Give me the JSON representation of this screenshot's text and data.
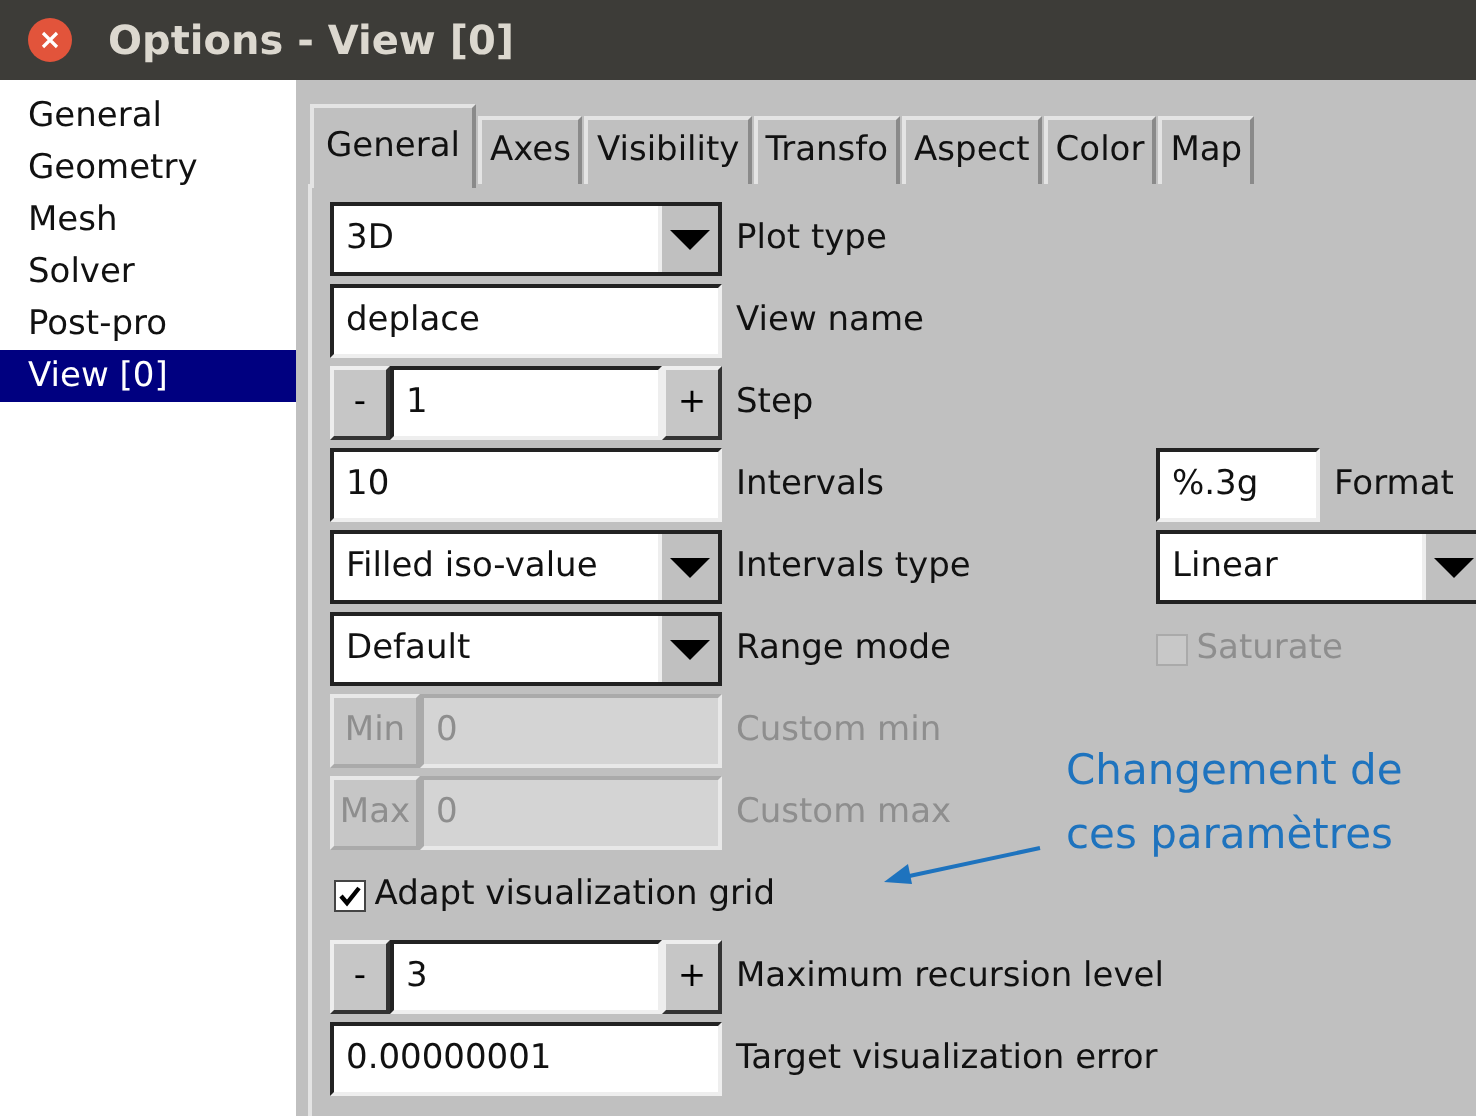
{
  "window": {
    "title": "Options - View [0]"
  },
  "sidebar": {
    "items": [
      {
        "label": "General",
        "selected": false
      },
      {
        "label": "Geometry",
        "selected": false
      },
      {
        "label": "Mesh",
        "selected": false
      },
      {
        "label": "Solver",
        "selected": false
      },
      {
        "label": "Post-pro",
        "selected": false
      },
      {
        "label": "View [0]",
        "selected": true
      }
    ]
  },
  "tabs": [
    {
      "label": "General",
      "selected": true
    },
    {
      "label": "Axes",
      "selected": false
    },
    {
      "label": "Visibility",
      "selected": false
    },
    {
      "label": "Transfo",
      "selected": false
    },
    {
      "label": "Aspect",
      "selected": false
    },
    {
      "label": "Color",
      "selected": false
    },
    {
      "label": "Map",
      "selected": false
    }
  ],
  "rows": [
    {
      "kind": "dropdown",
      "value": "3D",
      "label": "Plot type",
      "disabled": false
    },
    {
      "kind": "text",
      "value": "deplace",
      "label": "View name",
      "disabled": false
    },
    {
      "kind": "spinner",
      "minus": "-",
      "value": "1",
      "plus": "+",
      "label": "Step",
      "disabled": false
    },
    {
      "kind": "text",
      "value": "10",
      "label": "Intervals",
      "disabled": false,
      "extra": {
        "kind": "text",
        "value": "%.3g",
        "label": "Format",
        "disabled": false
      }
    },
    {
      "kind": "dropdown",
      "value": "Filled iso-value",
      "label": "Intervals type",
      "disabled": false,
      "extra": {
        "kind": "dropdown",
        "value": "Linear",
        "disabled": false
      }
    },
    {
      "kind": "dropdown",
      "value": "Default",
      "label": "Range mode",
      "disabled": false,
      "extra": {
        "kind": "checkbox",
        "text": "Saturate",
        "checked": false,
        "disabled": true
      }
    },
    {
      "kind": "button-input",
      "button": "Min",
      "value": "0",
      "label": "Custom min",
      "disabled": true
    },
    {
      "kind": "button-input",
      "button": "Max",
      "value": "0",
      "label": "Custom max",
      "disabled": true
    },
    {
      "kind": "checkbox",
      "text": "Adapt visualization grid",
      "checked": true,
      "disabled": false
    },
    {
      "kind": "spinner",
      "minus": "-",
      "value": "3",
      "plus": "+",
      "label": "Maximum recursion level",
      "disabled": false
    },
    {
      "kind": "text",
      "value": "0.00000001",
      "label": "Target visualization error",
      "disabled": false
    }
  ],
  "annotation": {
    "text": "Changement de ces paramètres"
  }
}
